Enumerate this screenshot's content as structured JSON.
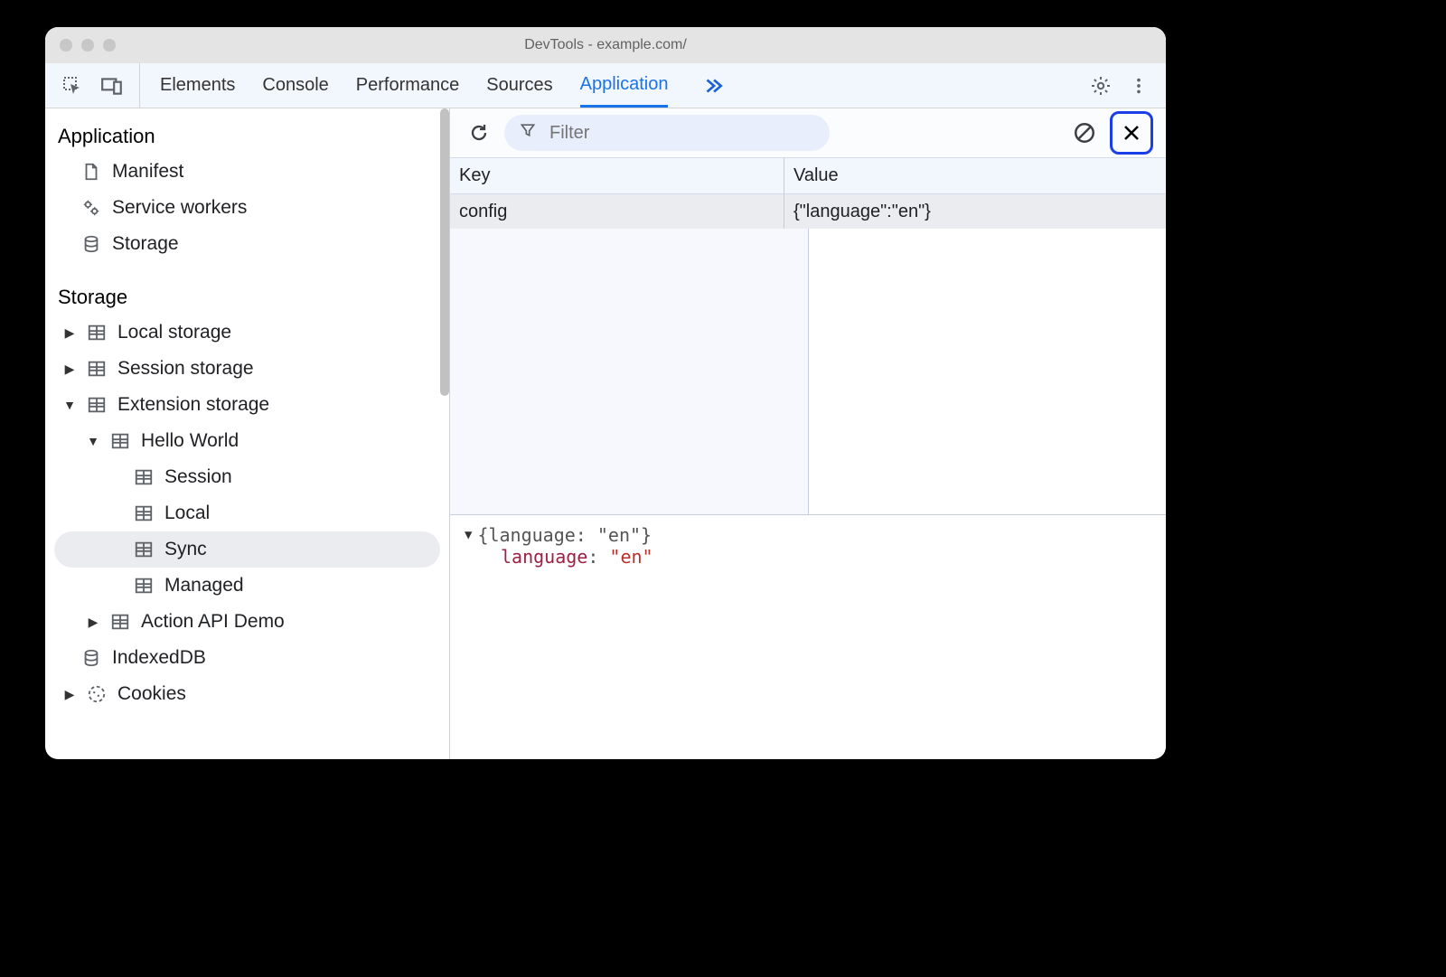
{
  "window": {
    "title": "DevTools - example.com/"
  },
  "tabs": {
    "elements": "Elements",
    "console": "Console",
    "performance": "Performance",
    "sources": "Sources",
    "application": "Application"
  },
  "sidebar": {
    "application": {
      "header": "Application",
      "manifest": "Manifest",
      "service_workers": "Service workers",
      "storage": "Storage"
    },
    "storage": {
      "header": "Storage",
      "local_storage": "Local storage",
      "session_storage": "Session storage",
      "extension_storage": "Extension storage",
      "hello_world": "Hello World",
      "session": "Session",
      "local": "Local",
      "sync": "Sync",
      "managed": "Managed",
      "action_api_demo": "Action API Demo",
      "indexeddb": "IndexedDB",
      "cookies": "Cookies"
    }
  },
  "main": {
    "filter_placeholder": "Filter",
    "columns": {
      "key": "Key",
      "value": "Value"
    },
    "rows": [
      {
        "key": "config",
        "value": "{\"language\":\"en\"}"
      }
    ],
    "detail": {
      "summary": "{language: \"en\"}",
      "prop_key": "language",
      "prop_colon": ": ",
      "prop_val": "\"en\""
    }
  }
}
